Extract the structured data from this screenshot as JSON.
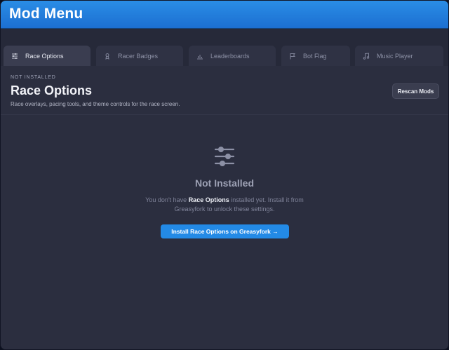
{
  "window": {
    "title": "Mod Menu"
  },
  "tabs": [
    {
      "label": "Race Options",
      "icon": "sliders-icon",
      "active": true
    },
    {
      "label": "Racer Badges",
      "icon": "badge-icon",
      "active": false
    },
    {
      "label": "Leaderboards",
      "icon": "chart-icon",
      "active": false
    },
    {
      "label": "Bot Flag",
      "icon": "flag-icon",
      "active": false
    },
    {
      "label": "Music Player",
      "icon": "music-icon",
      "active": false
    }
  ],
  "header": {
    "status": "NOT INSTALLED",
    "title": "Race Options",
    "description": "Race overlays, pacing tools, and theme controls for the race screen.",
    "rescan_label": "Rescan Mods"
  },
  "empty_state": {
    "icon": "sliders-icon",
    "title": "Not Installed",
    "text_prefix": "You don't have ",
    "text_bold": "Race Options",
    "text_suffix": " installed yet. Install it from",
    "text_line2": "Greasyfork to unlock these settings.",
    "install_label": "Install Race Options on Greasyfork →"
  },
  "colors": {
    "accent": "#238ae6",
    "title_bar": "#1c6fd1",
    "panel_bg": "#2b2e3f"
  }
}
